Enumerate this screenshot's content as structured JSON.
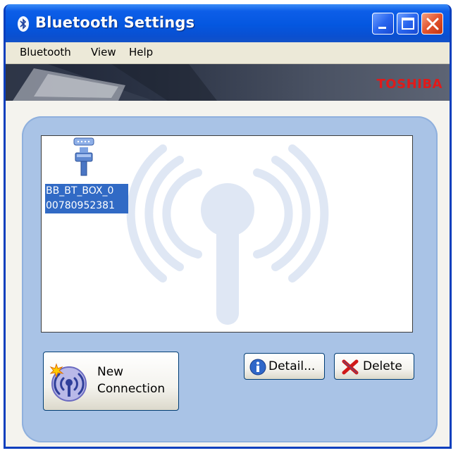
{
  "window": {
    "title": "Bluetooth Settings"
  },
  "icons": {
    "title": "bluetooth-icon",
    "minimize": "minimize-icon",
    "maximize": "maximize-icon",
    "close": "close-icon",
    "device": "serial-port-device-icon",
    "watermark": "wireless-antenna-watermark",
    "new_connection": "new-connection-antenna-icon",
    "detail": "info-icon",
    "delete": "red-x-icon"
  },
  "menu": {
    "items": [
      "Bluetooth",
      "View",
      "Help"
    ]
  },
  "banner": {
    "brand": "TOSHIBA"
  },
  "device": {
    "name_line1": "BB_BT_BOX_0",
    "name_line2": "00780952381"
  },
  "buttons": {
    "new_connection_line1": "New",
    "new_connection_line2": "Connection",
    "detail": "Detail...",
    "delete": "Delete"
  },
  "colors": {
    "title_bar": "#0457e0",
    "selection": "#316ac5",
    "panel": "#a9c3e6",
    "brand": "#e01a1a"
  }
}
